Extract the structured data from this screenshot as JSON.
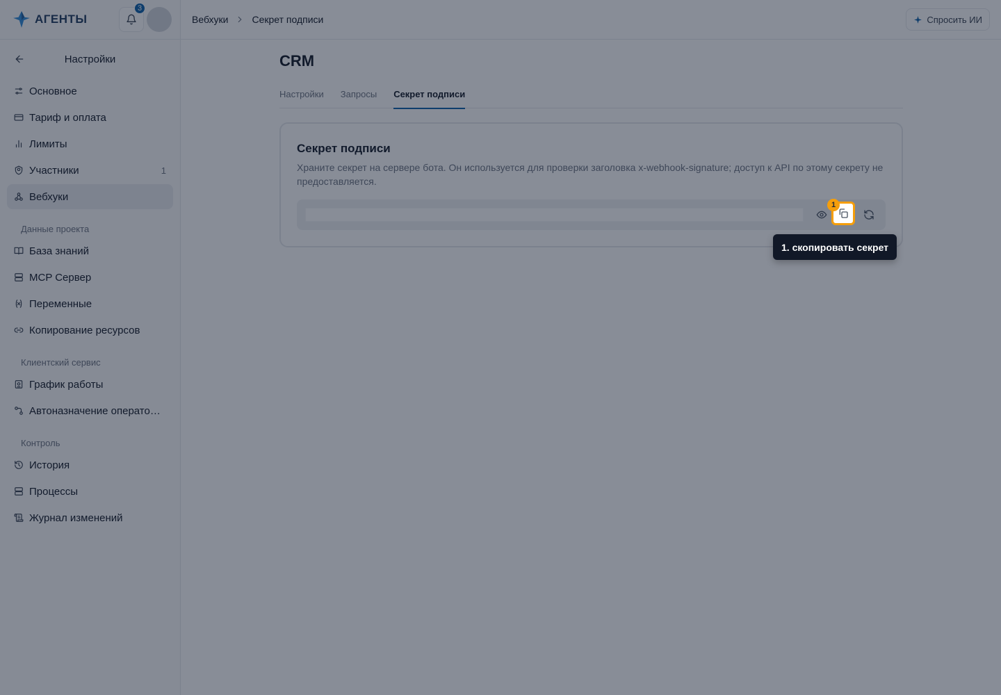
{
  "app": {
    "name": "АГЕНТЫ",
    "notifications_count": "3"
  },
  "sidebar": {
    "title": "Настройки",
    "items": [
      {
        "label": "Основное",
        "icon": "sliders-icon"
      },
      {
        "label": "Тариф и оплата",
        "icon": "credit-card-icon"
      },
      {
        "label": "Лимиты",
        "icon": "bar-chart-icon"
      },
      {
        "label": "Участники",
        "icon": "users-icon",
        "count": "1"
      },
      {
        "label": "Вебхуки",
        "icon": "webhook-icon",
        "active": true
      }
    ],
    "groups": [
      {
        "title": "Данные проекта",
        "items": [
          {
            "label": "База знаний",
            "icon": "book-icon"
          },
          {
            "label": "MCP Сервер",
            "icon": "server-icon"
          },
          {
            "label": "Переменные",
            "icon": "variable-icon"
          },
          {
            "label": "Копирование ресурсов",
            "icon": "link-icon"
          }
        ]
      },
      {
        "title": "Клиентский сервис",
        "items": [
          {
            "label": "График работы",
            "icon": "calendar-icon"
          },
          {
            "label": "Автоназначение операторов",
            "icon": "share-icon"
          }
        ]
      },
      {
        "title": "Контроль",
        "items": [
          {
            "label": "История",
            "icon": "history-icon"
          },
          {
            "label": "Процессы",
            "icon": "layers-icon"
          },
          {
            "label": "Журнал изменений",
            "icon": "scroll-icon"
          }
        ]
      }
    ]
  },
  "header": {
    "breadcrumb": [
      "Вебхуки",
      "Секрет подписи"
    ],
    "ask_ai_label": "Спросить ИИ"
  },
  "main": {
    "title": "CRM",
    "tabs": [
      {
        "label": "Настройки",
        "active": false
      },
      {
        "label": "Запросы",
        "active": false
      },
      {
        "label": "Секрет подписи",
        "active": true
      }
    ],
    "card": {
      "title": "Секрет подписи",
      "description": "Храните секрет на сервере бота. Он используется для проверки заголовка x-webhook-signature; доступ к API по этому секрету не предоставляется."
    }
  },
  "guide": {
    "step_number": "1",
    "tooltip": "1. скопировать секрет"
  },
  "colors": {
    "accent": "#0b5ea8",
    "highlight": "#f59e0b",
    "tooltip_bg": "#111827"
  }
}
